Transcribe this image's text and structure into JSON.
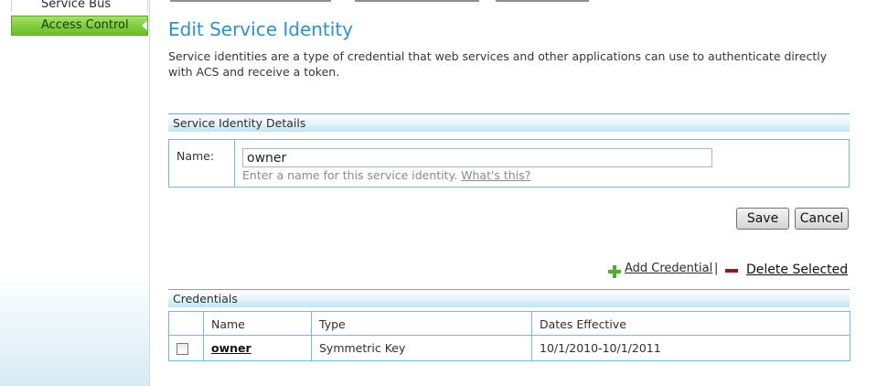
{
  "nav": {
    "items": [
      {
        "label": "Service Bus"
      },
      {
        "label": "Access Control"
      }
    ]
  },
  "page": {
    "title": "Edit Service Identity",
    "description": "Service identities are a type of credential that web services and other applications can use to authenticate directly with ACS and receive a token."
  },
  "details": {
    "header": "Service Identity Details",
    "name_label": "Name:",
    "name_value": "owner",
    "hint_text": "Enter a name for this service identity.",
    "hint_link": "What's this?"
  },
  "buttons": {
    "save": "Save",
    "cancel": "Cancel"
  },
  "credentials": {
    "add_label": "Add Credential",
    "separator": "|",
    "delete_label": "Delete Selected",
    "header": "Credentials",
    "columns": [
      "Name",
      "Type",
      "Dates Effective"
    ],
    "rows": [
      {
        "name": "owner",
        "type": "Symmetric Key",
        "dates": "10/1/2010-10/1/2011",
        "checked": false
      }
    ]
  },
  "colors": {
    "title": "#2f8fd4",
    "nav_active": "#7fcc3a",
    "section_border": "#6cc0de",
    "add_icon": "#4eae2e",
    "delete_icon": "#a0121a"
  }
}
